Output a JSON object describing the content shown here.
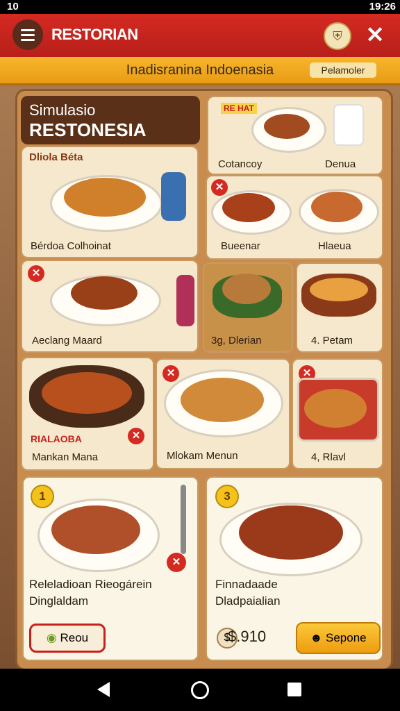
{
  "status_bar": {
    "time": "10",
    "clock": "19:26"
  },
  "app_bar": {
    "title": "RESTORIAN"
  },
  "banner": {
    "title": "Inadisranina Indoenasia",
    "button_label": "Pelamoler"
  },
  "header": {
    "line1": "Simulasio",
    "line2": "RESTONESIA"
  },
  "cards": {
    "top_banner_badge": "RE HAT",
    "c1_tag": "Dliola Béta",
    "c1_name": "Bérdoa Colhoinat",
    "c_top_left": "Cotancoy",
    "c_top_right": "Denua",
    "c2_left": "Bueenar",
    "c2_right": "Hlaeua",
    "c3_name": "Aeclang Maard",
    "c4_name": "3g, Dlerian",
    "c5_name": "4. Petam",
    "c6_tag": "RIALAOBA",
    "c6_name": "Mankan Mana",
    "c7_name": "Mlokam Menun",
    "c8_name": "4, Rlavl",
    "c9_title": "Releladioan Rieogárein",
    "c9_subtitle": "Dinglaldam",
    "c9_button": "Reou",
    "c9_badge": "1",
    "c10_title": "Finnadaade",
    "c10_subtitle": "Dladpaialian",
    "c10_price": "$.910",
    "c10_button": "Sepone",
    "c10_badge": "3"
  },
  "icons": [
    "menu-icon",
    "shield-badge-icon",
    "close-icon",
    "back-icon",
    "home-icon",
    "recent-apps-icon"
  ],
  "colors": {
    "app_bar": "#c62420",
    "banner": "#f0a820",
    "board": "#c98c4f",
    "card": "#f5e8cc"
  }
}
